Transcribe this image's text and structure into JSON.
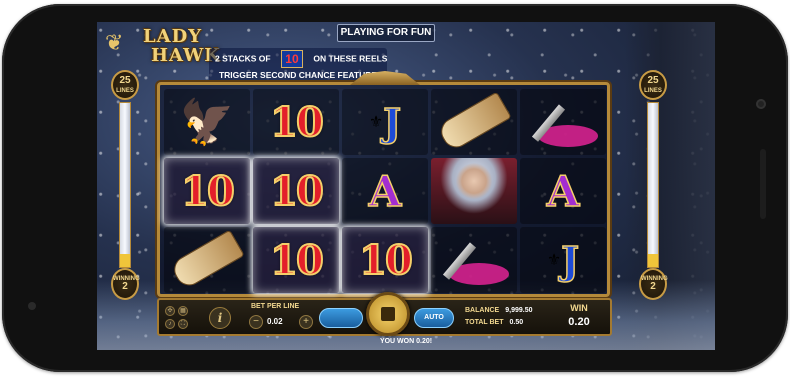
{
  "header": {
    "logo_line1": "LADY",
    "logo_line2": "HAWK",
    "mode_label": "PLAYING FOR FUN",
    "feature_text_left": "2 STACKS OF",
    "feature_badge": "10",
    "feature_text_right": "ON THESE REELS",
    "feature_text_line2": "TRIGGER SECOND CHANCE FEATURE"
  },
  "meters": {
    "left": {
      "top_value": "25",
      "top_label": "LINES",
      "bottom_label": "WINNING",
      "bottom_value": "2",
      "fill_fraction": 0.08
    },
    "right": {
      "top_value": "25",
      "top_label": "LINES",
      "bottom_label": "WINNING",
      "bottom_value": "2",
      "fill_fraction": 0.08
    }
  },
  "reels": {
    "rows": [
      [
        "eagle",
        "10",
        "J",
        "glove",
        "dagger"
      ],
      [
        "10",
        "10",
        "A",
        "heroine",
        "A"
      ],
      [
        "glove",
        "10",
        "10",
        "dagger",
        "J"
      ]
    ],
    "winning": [
      [
        false,
        false,
        false,
        false,
        false
      ],
      [
        true,
        true,
        false,
        false,
        false
      ],
      [
        false,
        true,
        true,
        false,
        false
      ]
    ]
  },
  "controls": {
    "info_label": "i",
    "bet_per_line_label": "BET PER LINE",
    "bet_per_line_value": "0.02",
    "minus_label": "−",
    "plus_label": "+",
    "max_bet_label": "",
    "auto_label": "AUTO",
    "balance_label": "BALANCE",
    "balance_value": "9,999.50",
    "total_bet_label": "TOTAL BET",
    "total_bet_value": "0.50",
    "win_label": "WIN",
    "win_value": "0.20"
  },
  "footer": {
    "message": "YOU WON 0.20!"
  },
  "colors": {
    "frame_gold": "#b58a3a",
    "ten_red": "#e31f2a",
    "j_blue": "#1d4bd8",
    "a_purple": "#a32ed0",
    "button_blue": "#1a5e9e"
  }
}
